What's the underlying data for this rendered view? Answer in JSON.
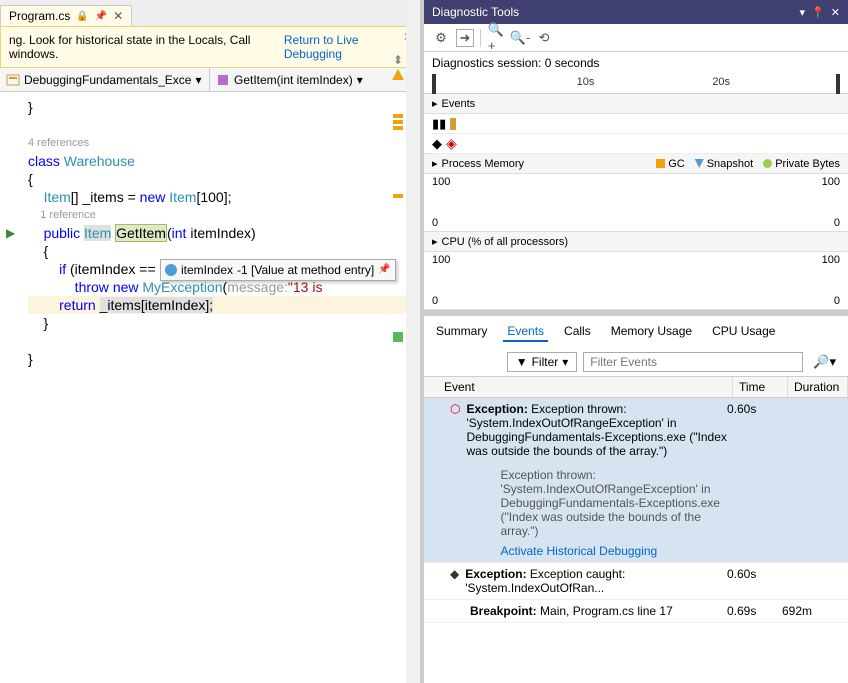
{
  "editor": {
    "tab": {
      "filename": "Program.cs",
      "lock": "🔒",
      "pin": "📌"
    },
    "yellow_bar": {
      "text_left": "ng. Look for historical state in the Locals, Call windows.",
      "link": "Return to Live Debugging"
    },
    "nav_left": "DebuggingFundamentals_Exce",
    "nav_right": "GetItem(int itemIndex)",
    "code": {
      "l1": "}",
      "ref1": "4 references",
      "l3a": "class",
      "l3b": "Warehouse",
      "l4": "{",
      "l5a": "Item",
      "l5b": "[] _items = ",
      "l5c": "new",
      "l5d": "Item",
      "l5e": "[100];",
      "ref2": "1 reference",
      "l7a": "public",
      "l7b": "Item",
      "l7c": "GetItem",
      "l7d": "(",
      "l7e": "int",
      "l7f": " itemIndex)",
      "l8": "    {",
      "l9a": "        if",
      "l9b": " (itemIndex == 13)",
      "l10a": "            throw",
      "l10b": "new",
      "l10c": "MyException",
      "l10d": "(",
      "l10e": "message:",
      "l10f": "\"13 is",
      "l11a": "        return",
      "l11b": "_items[itemIndex];",
      "l12": "    }",
      "l14": "}"
    },
    "debug_tip": {
      "var": "itemIndex",
      "val": "-1 [Value at method entry]"
    }
  },
  "diag": {
    "title": "Diagnostic Tools",
    "session": "Diagnostics session: 0 seconds",
    "timeline": {
      "t10": "10s",
      "t20": "20s"
    },
    "sections": {
      "events": "Events",
      "memory": "Process Memory",
      "cpu": "CPU (% of all processors)"
    },
    "legend": {
      "gc": "GC",
      "snap": "Snapshot",
      "pb": "Private Bytes"
    },
    "mem_top": "100",
    "mem_bot": "0",
    "cpu_top": "100",
    "cpu_bot": "0",
    "tabs": {
      "summary": "Summary",
      "events": "Events",
      "calls": "Calls",
      "mem": "Memory Usage",
      "cpu": "CPU Usage"
    },
    "filter_btn": "Filter",
    "filter_ph": "Filter Events",
    "cols": {
      "event": "Event",
      "time": "Time",
      "dur": "Duration"
    },
    "ev1": {
      "head": "Exception:",
      "body": "Exception thrown: 'System.IndexOutOfRangeException' in DebuggingFundamentals-Exceptions.exe (\"Index was outside the bounds of the array.\")",
      "sub": "Exception thrown: 'System.IndexOutOfRangeException' in DebuggingFundamentals-Exceptions.exe (\"Index was outside the bounds of the array.\")",
      "link": "Activate Historical Debugging",
      "time": "0.60s"
    },
    "ev2": {
      "head": "Exception:",
      "body": "Exception caught: 'System.IndexOutOfRan...",
      "time": "0.60s"
    },
    "ev3": {
      "head": "Breakpoint:",
      "body": "Main, Program.cs line 17",
      "time": "0.69s",
      "dur": "692m"
    }
  }
}
